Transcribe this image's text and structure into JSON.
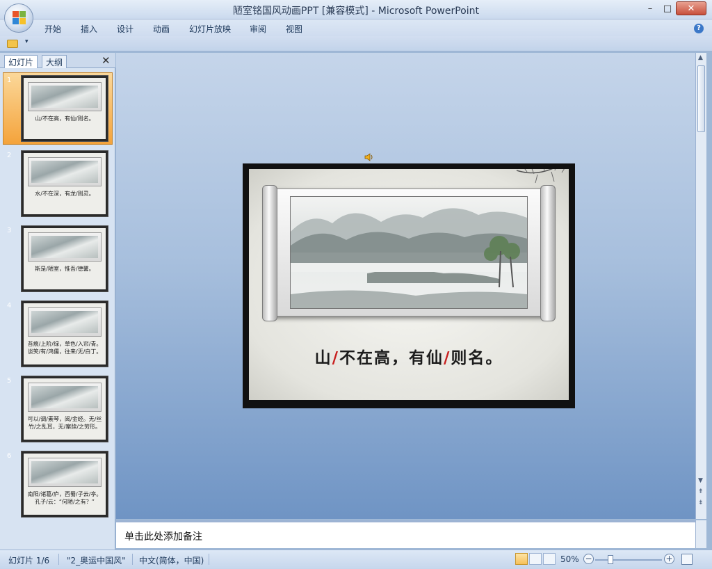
{
  "window": {
    "title": "陋室铭国风动画PPT [兼容模式] - Microsoft PowerPoint",
    "minimize_label": "–",
    "maximize_label": "□",
    "close_label": "✕"
  },
  "ribbon": {
    "tabs": [
      "开始",
      "插入",
      "设计",
      "动画",
      "幻灯片放映",
      "审阅",
      "视图"
    ],
    "help_label": "?"
  },
  "qat": {
    "dropdown_label": "▾"
  },
  "left_pane": {
    "tabs": [
      "幻灯片",
      "大纲"
    ],
    "close_label": "✕",
    "slides": [
      {
        "number": "1",
        "caption": "山/不在高，有仙/则名。"
      },
      {
        "number": "2",
        "caption": "水/不在深，有龙/则灵。"
      },
      {
        "number": "3",
        "caption": "斯是/陋室，惟吾/德馨。"
      },
      {
        "number": "4",
        "caption": "苔痕/上阶/绿，草色/入帘/青。谈笑/有/鸿儒，往来/无/白丁。"
      },
      {
        "number": "5",
        "caption": "可以/调/素琴，阅/金经。无/丝竹/之乱耳，无/案牍/之劳形。"
      },
      {
        "number": "6",
        "caption": "南阳/诸葛/庐，西蜀/子云/亭。孔子/云：“何陋/之有？”"
      }
    ]
  },
  "slide": {
    "caption_parts": [
      "山",
      "/",
      "不在高，有仙",
      "/",
      "则名。"
    ]
  },
  "notes": {
    "placeholder": "单击此处添加备注"
  },
  "statusbar": {
    "slide_position": "幻灯片 1/6",
    "theme": "\"2_奥运中国风\"",
    "language": "中文(简体，中国)",
    "zoom": "50%",
    "zoom_out": "−",
    "zoom_in": "+"
  },
  "colors": {
    "selected_thumb": "#f4a33b",
    "workspace_top": "#c5d5ea",
    "workspace_bottom": "#6f94c4",
    "caption_separator": "#c82020"
  }
}
